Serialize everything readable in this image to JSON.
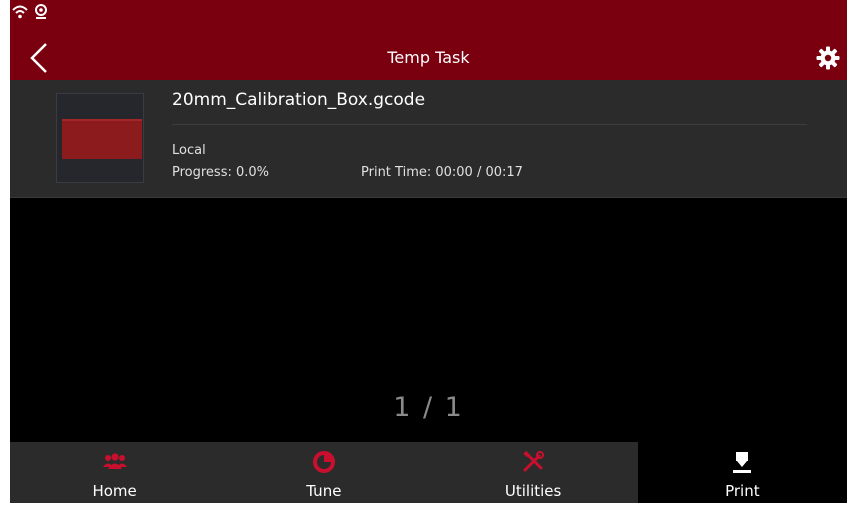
{
  "header": {
    "title": "Temp Task",
    "color": "#7a0010",
    "status_icons": [
      "wifi-icon",
      "webcam-icon"
    ],
    "back_icon": "back-chevron-icon",
    "settings_icon": "gear-icon"
  },
  "task": {
    "file_name": "20mm_Calibration_Box.gcode",
    "source": "Local",
    "progress_text": "Progress: 0.0%",
    "progress_value": 0.0,
    "print_time_text": "Print Time: 00:00 / 00:17"
  },
  "pager": {
    "text": "1 / 1"
  },
  "nav": {
    "accent": "#c8102e",
    "active": "Print",
    "items": [
      {
        "label": "Home",
        "icon": "users-icon"
      },
      {
        "label": "Tune",
        "icon": "pie-chart-icon"
      },
      {
        "label": "Utilities",
        "icon": "tools-icon"
      },
      {
        "label": "Print",
        "icon": "print-nozzle-icon"
      }
    ]
  }
}
